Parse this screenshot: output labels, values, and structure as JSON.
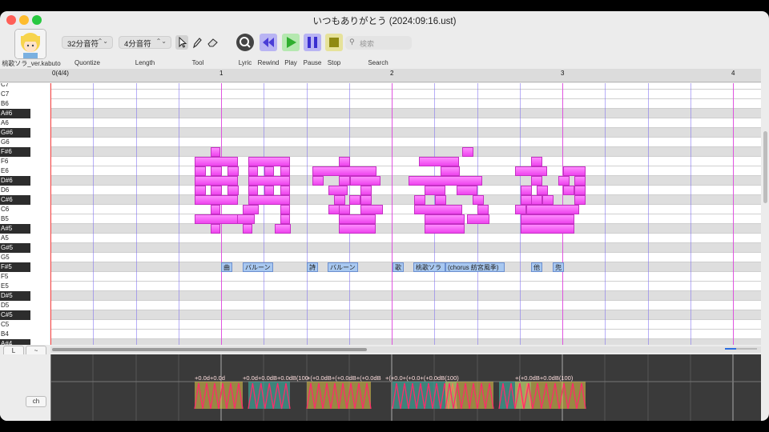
{
  "window": {
    "title": "いつもありがとう (2024:09:16.ust)"
  },
  "traffic": {
    "close": "#ff5f57",
    "minimize": "#febc2e",
    "maximize": "#28c840"
  },
  "toolbar": {
    "singer_name": "桃歌ソラ_ver.kabuto",
    "quantize_value": "32分音符",
    "quantize_label": "Quontize",
    "length_value": "4分音符",
    "length_label": "Length",
    "tool_label": "Tool",
    "lyric_label": "Lyric",
    "rewind_label": "Rewind",
    "play_label": "Play",
    "pause_label": "Pause",
    "stop_label": "Stop",
    "search_placeholder": "検索",
    "search_label": "Search"
  },
  "ruler": {
    "measures": [
      "0(4/4)",
      "1",
      "2",
      "3",
      "4"
    ]
  },
  "keys": [
    "C7",
    "C7",
    "B6",
    "A#6",
    "A6",
    "G#6",
    "G6",
    "F#6",
    "F6",
    "E6",
    "D#6",
    "D6",
    "C#6",
    "C6",
    "B5",
    "A#5",
    "A5",
    "G#5",
    "G5",
    "F#5",
    "F5",
    "E5",
    "D#5",
    "D5",
    "C#5",
    "C5",
    "B4",
    "A#4"
  ],
  "lyrics": [
    {
      "text": "曲"
    },
    {
      "text": "バルーン"
    },
    {
      "text": "詩"
    },
    {
      "text": "バルーン"
    },
    {
      "text": "歌"
    },
    {
      "text": "桃歌ソラ"
    },
    {
      "text": "(chorus 紡宮風季)"
    },
    {
      "text": "他"
    },
    {
      "text": "兜"
    }
  ],
  "side_buttons": {
    "l": "L",
    "tilde": "~",
    "ch": "ch"
  },
  "pitch_labels": [
    "+0.0d+0.0d",
    "+0.0d+0.0dB+0.0dB(100",
    "+(+0.0dB+(+0.0dB+(+0.0dB",
    "+(+0.0+(+0.0+(+0.0dB(100)",
    "+(+0.0dB+0.0dB(100)"
  ],
  "colors": {
    "note_fill": "#ff66ff",
    "lyric_fill": "#a8c8f0",
    "measure_line": "#dd44dd",
    "beat_line": "#7b6cf0",
    "pitch_line": "#ff2a6a",
    "pitch_box_teal": "#3fbfae",
    "pitch_box_yellow": "#e6c94a"
  }
}
